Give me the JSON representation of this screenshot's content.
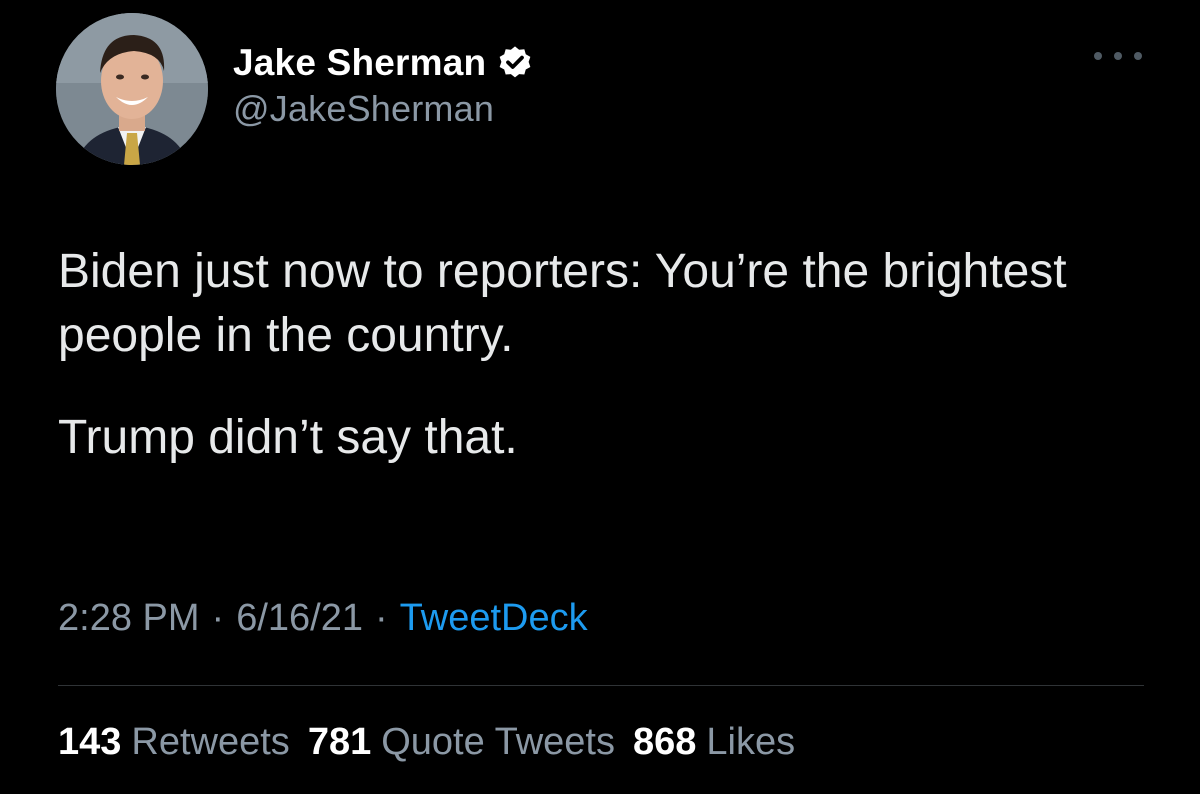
{
  "author": {
    "display_name": "Jake Sherman",
    "handle": "@JakeSherman",
    "verified": true
  },
  "tweet": {
    "paragraphs": [
      "Biden just now to reporters: You’re the brightest people in the country.",
      "Trump didn’t say that."
    ]
  },
  "meta": {
    "time": "2:28 PM",
    "date": "6/16/21",
    "separator": "·",
    "source": "TweetDeck"
  },
  "stats": {
    "retweets_count": "143",
    "retweets_label": "Retweets",
    "quotes_count": "781",
    "quotes_label": "Quote Tweets",
    "likes_count": "868",
    "likes_label": "Likes"
  },
  "icons": {
    "more": "more-options-icon",
    "verified": "verified-badge-icon"
  },
  "colors": {
    "background": "#000000",
    "text": "#e7e9ea",
    "secondary": "#8b98a5",
    "accent": "#1d9bf0",
    "divider": "#2f3336"
  }
}
